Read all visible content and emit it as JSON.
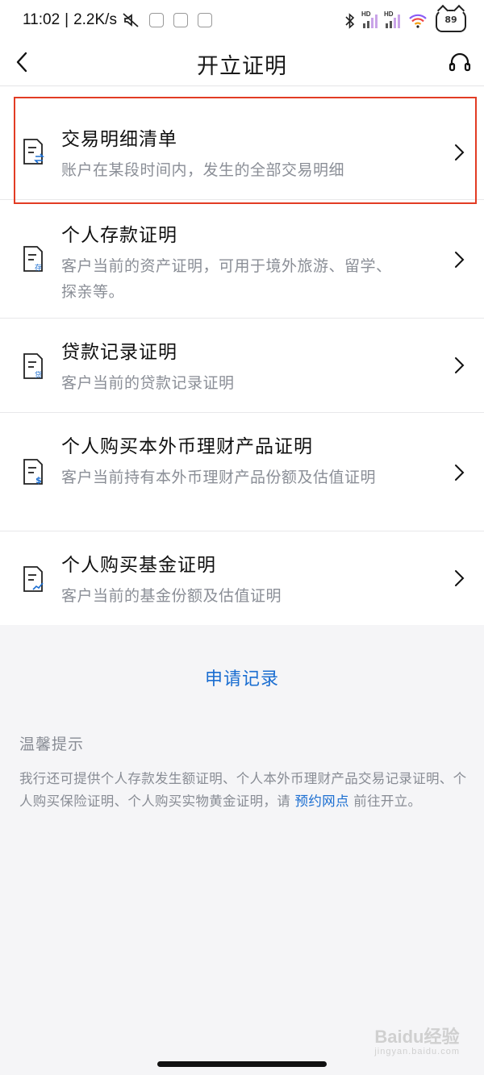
{
  "status_bar": {
    "time": "11:02",
    "speed": "2.2K/s",
    "hd_label": "HD",
    "battery": "89"
  },
  "header": {
    "title": "开立证明"
  },
  "items": [
    {
      "title": "交易明细清单",
      "desc": "账户在某段时间内，发生的全部交易明细",
      "icon": "document-transfer-icon"
    },
    {
      "title": "个人存款证明",
      "desc": "客户当前的资产证明，可用于境外旅游、留学、探亲等。",
      "icon": "document-deposit-icon"
    },
    {
      "title": "贷款记录证明",
      "desc": "客户当前的贷款记录证明",
      "icon": "document-loan-icon"
    },
    {
      "title": "个人购买本外币理财产品证明",
      "desc": "客户当前持有本外币理财产品份额及估值证明",
      "icon": "document-dollar-icon"
    },
    {
      "title": "个人购买基金证明",
      "desc": "客户当前的基金份额及估值证明",
      "icon": "document-chart-icon"
    }
  ],
  "application_record": "申请记录",
  "tips": {
    "title": "温馨提示",
    "text_before": "我行还可提供个人存款发生额证明、个人本外币理财产品交易记录证明、个人购买保险证明、个人购买实物黄金证明，请 ",
    "link": "预约网点",
    "text_after": " 前往开立。"
  },
  "watermark": {
    "brand": "Baidu经验",
    "url": "jingyan.baidu.com"
  },
  "colors": {
    "accent": "#1b6ed1",
    "highlight": "#e23c24"
  }
}
